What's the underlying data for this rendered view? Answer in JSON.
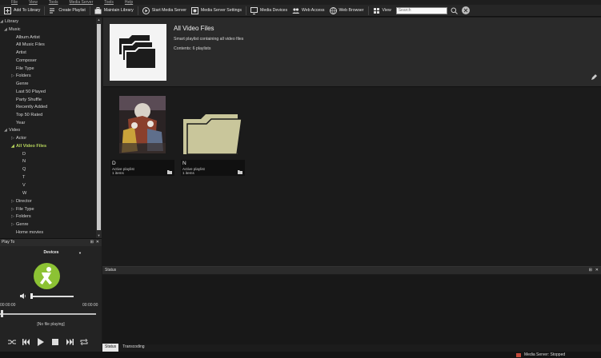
{
  "menu": [
    "File",
    "View",
    "Tools",
    "Media Server",
    "Tools",
    "Help"
  ],
  "toolbar": {
    "add_library": "Add To Library",
    "create_playlist": "Create Playlist",
    "maintain_library": "Maintain Library",
    "start_server": "Start Media Server",
    "server_settings": "Media Server Settings",
    "media_devices": "Media Devices",
    "web_access": "Web Access",
    "web_browser": "Web Browser",
    "view": "View",
    "search_placeholder": "Search"
  },
  "tree": {
    "library": "Library",
    "music": "Music",
    "music_items": [
      "Album Artist",
      "All Music Files",
      "Artist",
      "Composer",
      "File Type",
      "Folders",
      "Genre",
      "Last 50 Played",
      "Party Shuffle",
      "Recently Added",
      "Top 50 Rated",
      "Year"
    ],
    "video": "Video",
    "actor": "Actor",
    "all_video_files": "All Video Files",
    "letters": [
      "D",
      "N",
      "Q",
      "T",
      "V",
      "W"
    ],
    "video_items": [
      "Director",
      "File Type",
      "Folders",
      "Genre",
      "Home movies"
    ]
  },
  "playto": {
    "title": "Play To",
    "device": "Devices",
    "time_left": "00:00:00",
    "time_right": "00:00:00",
    "no_file": "[No file playing]"
  },
  "header": {
    "title": "All Video Files",
    "description": "Smart playlist containing all video files",
    "contents": "Contents: 6 playlists"
  },
  "cards": [
    {
      "name": "D",
      "line1": "Active playlist",
      "line2": "1 items"
    },
    {
      "name": "N",
      "line1": "Active playlist",
      "line2": "1 items"
    }
  ],
  "status": {
    "title": "Status",
    "tab_status": "Status",
    "tab_transcoding": "Transcoding"
  },
  "statusbar": {
    "text": "Media Server: Stopped"
  },
  "colors": {
    "accent_green": "#b6d45c",
    "logo_green": "#8cc234",
    "folder": "#c9c69b"
  }
}
